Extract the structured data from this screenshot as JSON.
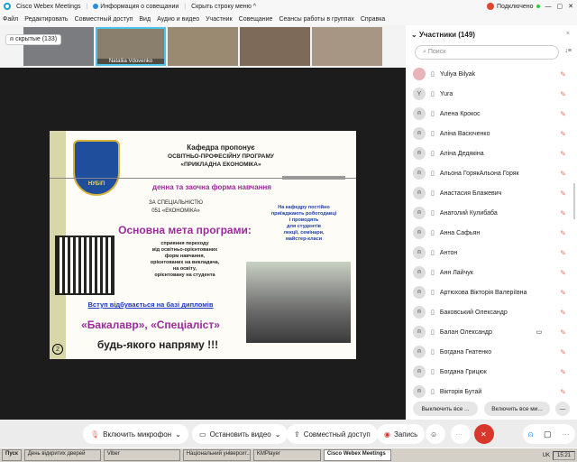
{
  "titlebar": {
    "app": "Cisco Webex Meetings",
    "info": "Информация о совещании",
    "hide": "Скрыть строку меню ^",
    "status": "Подключено"
  },
  "menu": [
    "Файл",
    "Редактировать",
    "Совместный доступ",
    "Вид",
    "Аудио и видео",
    "Участник",
    "Совещание",
    "Сеансы работы в группах",
    "Справка"
  ],
  "strip": {
    "hidden": "скрытые (133)",
    "active_name": "Nataliia Vdovenko"
  },
  "slide": {
    "l1": "Кафедра пропонує",
    "l2": "ОСВІТНЬО-ПРОФЕСІЙНУ ПРОГРАМУ",
    "l3": "«ПРИКЛАДНА ЕКОНОМІКА»",
    "form": "денна та заочна форма навчання",
    "spec1": "ЗА СПЕЦІАЛЬНІСТЮ",
    "spec2": "051 «ЕКОНОМІКА»",
    "side1": "На кафедру постійно",
    "side2": "приїжджають роботодавці",
    "side3": "і проводять",
    "side4": "для студентів",
    "side5": "лекції, семінари,",
    "side6": "майстер-класи",
    "goal": "Основна мета програми:",
    "g1": "сприяння переходу",
    "g2": "від освітньо-орієнтованих",
    "g3": "форм навчання,",
    "g4": "орієнтованих на викладача,",
    "g5": "на освіту,",
    "g6": "орієнтовану на студента",
    "entry": "Вступ відбувається на базі дипломів",
    "degrees": "«Бакалавр», «Спеціаліст»",
    "any": "будь-якого напряму !!!",
    "page": "2",
    "logo": "НУБіП"
  },
  "panel": {
    "title": "Участники (149)",
    "search_placeholder": "Поиск",
    "participants": [
      "Yuliya Bilyak",
      "Yura",
      "Алена Крокос",
      "Аліна Васюченко",
      "Аліна Дедякіна",
      "Альона ГорякАльона Горяк",
      "Анастасия Блажевич",
      "Анатолий Кулибаба",
      "Анна Сафьян",
      "Антон",
      "Анн Лайчук",
      "Артюхова Вікторія Валеріївна",
      "Баковський Олександр",
      "Балан Олександр",
      "Богдана Гнатенко",
      "Богдана Грицюк",
      "Вікторія Бутай"
    ],
    "mute_all": "Выключить все ...",
    "unmute_all": "Включить все ми..."
  },
  "toolbar": {
    "mic": "Включить микрофон",
    "video": "Остановить видео",
    "share": "Совместный доступ",
    "record": "Запись"
  },
  "taskbar": {
    "start": "Пуск",
    "tasks": [
      "День відкритих дверей",
      "Viber",
      "Національний університ...",
      "KMPlayer",
      "Cisco Webex Meetings"
    ],
    "lang": "UK",
    "time": "15:21"
  },
  "colors": {
    "accent": "#00a0d1",
    "end": "#d8382b",
    "purple": "#9b2a9a"
  }
}
